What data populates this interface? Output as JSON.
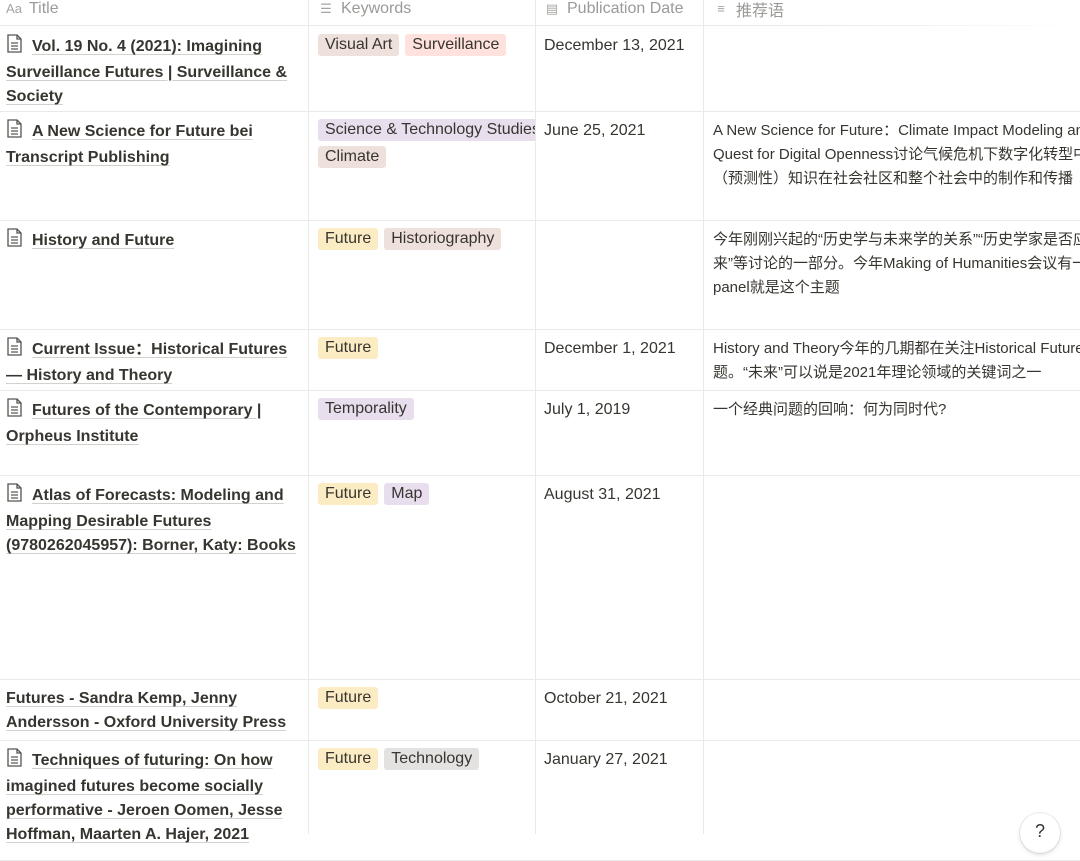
{
  "header": {
    "title": {
      "icon": "Aa",
      "label": "Title"
    },
    "keywords": {
      "icon": "☰",
      "label": "Keywords"
    },
    "date": {
      "icon": "▤",
      "label": "Publication Date"
    },
    "rec": {
      "icon": "≡",
      "label": "推荐语"
    }
  },
  "colors": {
    "tag_brown": "#eee0da",
    "tag_red": "#ffe2dd",
    "tag_purple": "#e8deee",
    "tag_yellow": "#fbecc3",
    "tag_gray": "#e3e2e0",
    "text": "#37352f",
    "muted": "#9b9a97"
  },
  "rows": [
    {
      "title": "Vol. 19 No. 4 (2021): Imagining Surveillance Futures | Surveillance & Society",
      "tags": [
        {
          "label": "Visual Art",
          "color": "brown"
        },
        {
          "label": "Surveillance",
          "color": "red"
        }
      ],
      "date": "December 13, 2021",
      "rec": []
    },
    {
      "title": "A New Science for Future bei Transcript Publishing",
      "tags": [
        {
          "label": "Science & Technology Studies",
          "color": "purple"
        },
        {
          "label": "Climate",
          "color": "brown"
        }
      ],
      "date": "June 25, 2021",
      "rec": [
        "A New Science for Future：Climate Impact Modeling and the",
        "Quest for Digital Openness讨论气候危机下数字化转型中未来",
        "（预测性）知识在社会社区和整个社会中的制作和传播"
      ]
    },
    {
      "title": "History and Future",
      "tags": [
        {
          "label": "Future",
          "color": "yellow"
        },
        {
          "label": "Historiography",
          "color": "brown"
        }
      ],
      "date": "",
      "rec": [
        "今年刚刚兴起的“历史学与未来学的关系”“历史学家是否应该关注未",
        "来”等讨论的一部分。今年Making of Humanities会议有一个",
        "panel就是这个主题"
      ]
    },
    {
      "title": "Current Issue：Historical Futures — History and Theory",
      "tags": [
        {
          "label": "Future",
          "color": "yellow"
        }
      ],
      "date": "December 1, 2021",
      "rec": [
        "History and Theory今年的几期都在关注Historical Futures的问",
        "题。“未来”可以说是2021年理论领域的关键词之一"
      ]
    },
    {
      "title": "Futures of the Contemporary | Orpheus Institute",
      "tags": [
        {
          "label": "Temporality",
          "color": "purple"
        }
      ],
      "date": "July 1, 2019",
      "rec": [
        "一个经典问题的回响：何为同时代?"
      ]
    },
    {
      "title": "Atlas of Forecasts: Modeling and Mapping Desirable Futures (9780262045957): Borner, Katy: Books",
      "tags": [
        {
          "label": "Future",
          "color": "yellow"
        },
        {
          "label": "Map",
          "color": "purple"
        }
      ],
      "date": "August 31, 2021",
      "rec": []
    },
    {
      "title": "Futures - Sandra Kemp, Jenny Andersson - Oxford University Press",
      "noicon": true,
      "tags": [
        {
          "label": "Future",
          "color": "yellow"
        }
      ],
      "date": "October 21, 2021",
      "rec": []
    },
    {
      "title": "Techniques of futuring: On how imagined futures become socially performative - Jeroen Oomen, Jesse Hoffman, Maarten A. Hajer, 2021",
      "tags": [
        {
          "label": "Future",
          "color": "yellow"
        },
        {
          "label": "Technology",
          "color": "gray"
        }
      ],
      "date": "January 27, 2021",
      "rec": []
    }
  ],
  "help": {
    "label": "?"
  }
}
